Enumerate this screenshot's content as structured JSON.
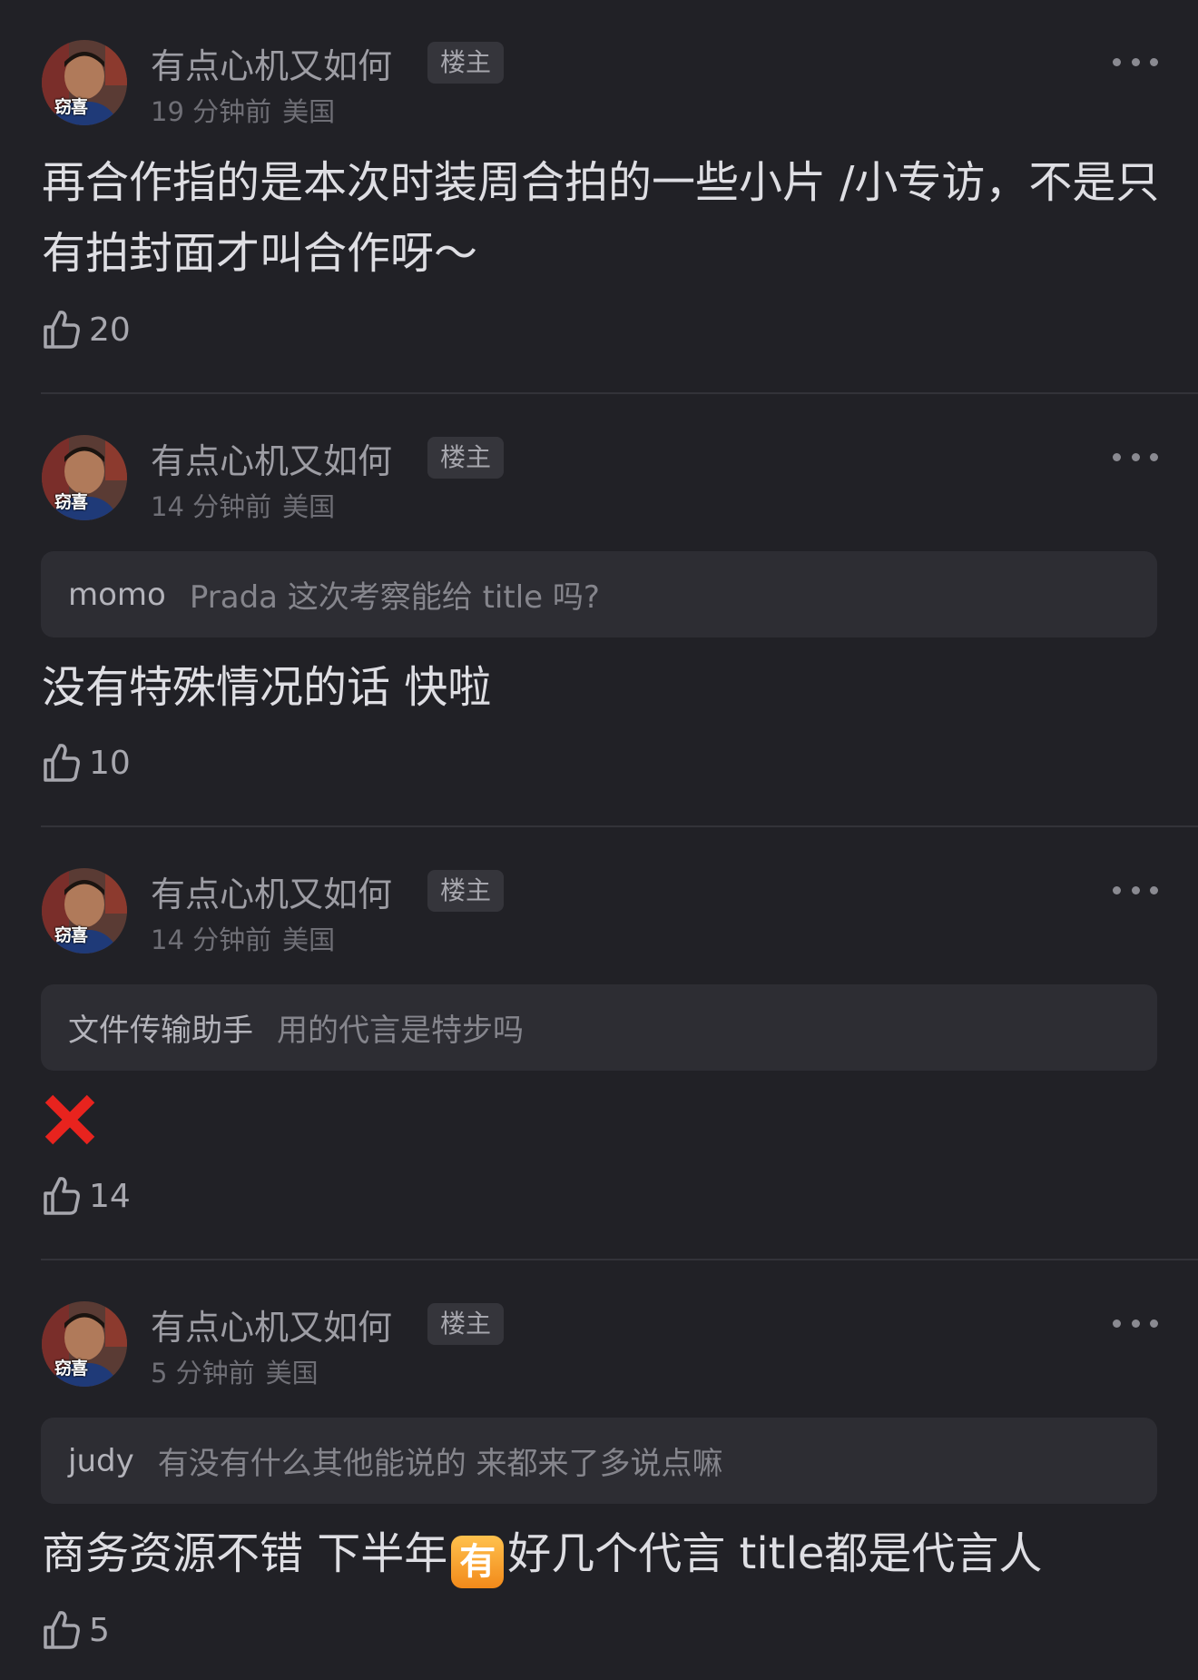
{
  "comments": [
    {
      "username": "有点心机又如何",
      "op_badge": "楼主",
      "avatar_caption": "窃喜",
      "time": "19 分钟前",
      "location": "美国",
      "text": "再合作指的是本次时装周合拍的一些小片 /小专访，不是只有拍封面才叫合作呀～",
      "likes": "20"
    },
    {
      "username": "有点心机又如何",
      "op_badge": "楼主",
      "avatar_caption": "窃喜",
      "time": "14 分钟前",
      "location": "美国",
      "quote_user": "momo",
      "quote_text": "Prada 这次考察能给 title 吗?",
      "text": "没有特殊情况的话 快啦",
      "likes": "10"
    },
    {
      "username": "有点心机又如何",
      "op_badge": "楼主",
      "avatar_caption": "窃喜",
      "time": "14 分钟前",
      "location": "美国",
      "quote_user": "文件传输助手",
      "quote_text": "用的代言是特步吗",
      "reply_icon": "red-cross-mark-icon",
      "likes": "14"
    },
    {
      "username": "有点心机又如何",
      "op_badge": "楼主",
      "avatar_caption": "窃喜",
      "time": "5 分钟前",
      "location": "美国",
      "quote_user": "judy",
      "quote_text": "有没有什么其他能说的 来都来了多说点嘛",
      "text_before": "商务资源不错 下半年",
      "inline_badge": "有",
      "text_after": "好几个代言 title都是代言人",
      "likes": "5"
    }
  ],
  "colors": {
    "background": "#212126",
    "username": "#9d9da4",
    "meta": "#6f6f76",
    "body_text": "#dedee3",
    "quote_background": "#2d2d33",
    "divider": "#333339",
    "reject_red": "#e8231e"
  }
}
